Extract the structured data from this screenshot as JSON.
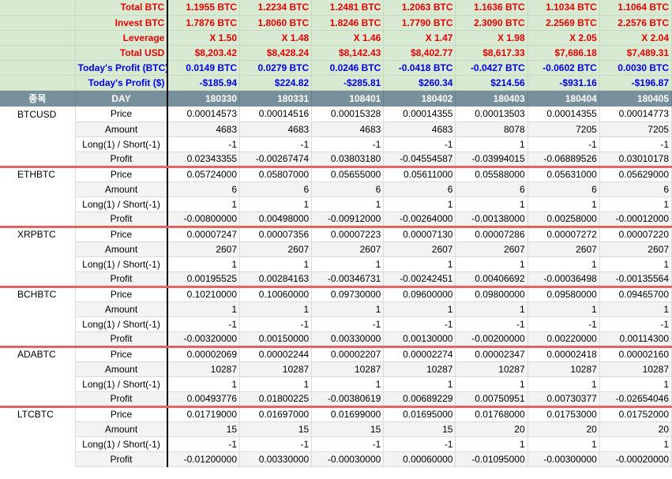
{
  "summary": [
    {
      "label": "Total BTC",
      "values": [
        "1.1955 BTC",
        "1.2234 BTC",
        "1.2481 BTC",
        "1.2063 BTC",
        "1.1636 BTC",
        "1.1034 BTC",
        "1.1064 BTC"
      ]
    },
    {
      "label": "Invest BTC",
      "values": [
        "1.7876 BTC",
        "1.8060 BTC",
        "1.8246 BTC",
        "1.7790 BTC",
        "2.3090 BTC",
        "2.2569 BTC",
        "2.2576 BTC"
      ]
    },
    {
      "label": "Leverage",
      "values": [
        "X 1.50",
        "X 1.48",
        "X 1.46",
        "X 1.47",
        "X 1.98",
        "X 2.05",
        "X 2.04"
      ]
    },
    {
      "label": "Total USD",
      "values": [
        "$8,203.42",
        "$8,428.24",
        "$8,142.43",
        "$8,402.77",
        "$8,617.33",
        "$7,686.18",
        "$7,489.31"
      ]
    },
    {
      "label": "Today's Profit (BTC)",
      "values": [
        "0.0149 BTC",
        "0.0279 BTC",
        "0.0246 BTC",
        "-0.0418 BTC",
        "-0.0427 BTC",
        "-0.0602 BTC",
        "0.0030 BTC"
      ]
    },
    {
      "label": "Today's Profit ($)",
      "values": [
        "-$185.94",
        "$224.82",
        "-$285.81",
        "$260.34",
        "$214.56",
        "-$931.16",
        "-$196.87"
      ]
    }
  ],
  "header": {
    "name_col": "종목",
    "day_col": "DAY",
    "days": [
      "180330",
      "180331",
      "108401",
      "180402",
      "180403",
      "180404",
      "180405"
    ]
  },
  "field_labels": [
    "Price",
    "Amount",
    "Long(1) / Short(-1)",
    "Profit"
  ],
  "coins": [
    {
      "name": "BTCUSD",
      "rows": [
        [
          "0.00014573",
          "0.00014516",
          "0.00015328",
          "0.00014355",
          "0.00013503",
          "0.00014355",
          "0.00014773"
        ],
        [
          "4683",
          "4683",
          "4683",
          "4683",
          "8078",
          "7205",
          "7205"
        ],
        [
          "-1",
          "-1",
          "-1",
          "-1",
          "1",
          "-1",
          "-1"
        ],
        [
          "0.02343355",
          "-0.00267474",
          "0.03803180",
          "-0.04554587",
          "-0.03994015",
          "-0.06889526",
          "0.03010178"
        ]
      ]
    },
    {
      "name": "ETHBTC",
      "rows": [
        [
          "0.05724000",
          "0.05807000",
          "0.05655000",
          "0.05611000",
          "0.05588000",
          "0.05631000",
          "0.05629000"
        ],
        [
          "6",
          "6",
          "6",
          "6",
          "6",
          "6",
          "6"
        ],
        [
          "1",
          "1",
          "1",
          "1",
          "1",
          "1",
          "1"
        ],
        [
          "-0.00800000",
          "0.00498000",
          "-0.00912000",
          "-0.00264000",
          "-0.00138000",
          "0.00258000",
          "-0.00012000"
        ]
      ]
    },
    {
      "name": "XRPBTC",
      "rows": [
        [
          "0.00007247",
          "0.00007356",
          "0.00007223",
          "0.00007130",
          "0.00007286",
          "0.00007272",
          "0.00007220"
        ],
        [
          "2607",
          "2607",
          "2607",
          "2607",
          "2607",
          "2607",
          "2607"
        ],
        [
          "1",
          "1",
          "1",
          "1",
          "1",
          "1",
          "1"
        ],
        [
          "0.00195525",
          "0.00284163",
          "-0.00346731",
          "-0.00242451",
          "0.00406692",
          "-0.00036498",
          "-0.00135564"
        ]
      ]
    },
    {
      "name": "BCHBTC",
      "rows": [
        [
          "0.10210000",
          "0.10060000",
          "0.09730000",
          "0.09600000",
          "0.09800000",
          "0.09580000",
          "0.09465700"
        ],
        [
          "1",
          "1",
          "1",
          "1",
          "1",
          "1",
          "1"
        ],
        [
          "-1",
          "-1",
          "-1",
          "-1",
          "-1",
          "-1",
          "-1"
        ],
        [
          "-0.00320000",
          "0.00150000",
          "0.00330000",
          "0.00130000",
          "-0.00200000",
          "0.00220000",
          "0.00114300"
        ]
      ]
    },
    {
      "name": "ADABTC",
      "rows": [
        [
          "0.00002069",
          "0.00002244",
          "0.00002207",
          "0.00002274",
          "0.00002347",
          "0.00002418",
          "0.00002160"
        ],
        [
          "10287",
          "10287",
          "10287",
          "10287",
          "10287",
          "10287",
          "10287"
        ],
        [
          "1",
          "1",
          "1",
          "1",
          "1",
          "1",
          "1"
        ],
        [
          "0.00493776",
          "0.01800225",
          "-0.00380619",
          "0.00689229",
          "0.00750951",
          "0.00730377",
          "-0.02654046"
        ]
      ]
    },
    {
      "name": "LTCBTC",
      "rows": [
        [
          "0.01719000",
          "0.01697000",
          "0.01699000",
          "0.01695000",
          "0.01768000",
          "0.01753000",
          "0.01752000"
        ],
        [
          "15",
          "15",
          "15",
          "15",
          "20",
          "20",
          "20"
        ],
        [
          "-1",
          "-1",
          "-1",
          "-1",
          "1",
          "1",
          "1"
        ],
        [
          "-0.01200000",
          "0.00330000",
          "-0.00030000",
          "0.00060000",
          "-0.01095000",
          "-0.00300000",
          "-0.00020000"
        ]
      ]
    }
  ]
}
